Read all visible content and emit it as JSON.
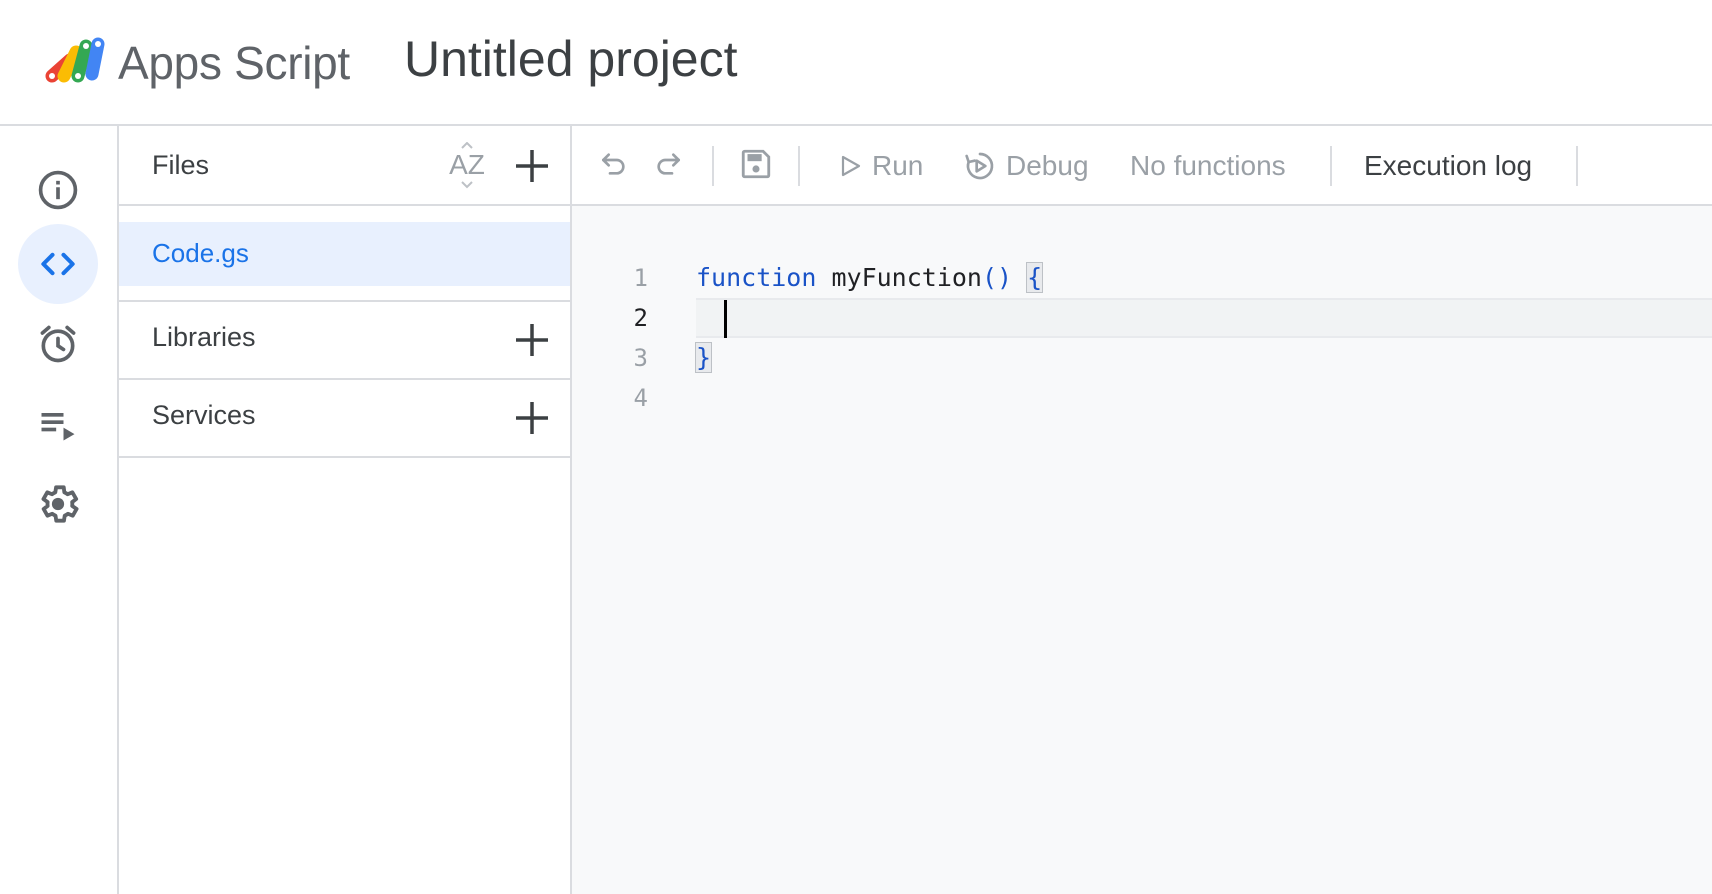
{
  "header": {
    "app_name": "Apps Script",
    "project_title": "Untitled project"
  },
  "rail": {
    "items": [
      {
        "name": "overview",
        "icon": "info-icon",
        "active": false
      },
      {
        "name": "editor",
        "icon": "code-icon",
        "active": true
      },
      {
        "name": "triggers",
        "icon": "alarm-clock-icon",
        "active": false
      },
      {
        "name": "executions",
        "icon": "playlist-play-icon",
        "active": false
      },
      {
        "name": "settings",
        "icon": "gear-icon",
        "active": false
      }
    ]
  },
  "files_panel": {
    "files_label": "Files",
    "sort_icon_text": "AZ",
    "files": [
      {
        "name": "Code.gs",
        "selected": true
      }
    ],
    "libraries_label": "Libraries",
    "services_label": "Services"
  },
  "toolbar": {
    "run_label": "Run",
    "debug_label": "Debug",
    "function_select": "No functions",
    "execution_log_label": "Execution log"
  },
  "editor": {
    "line_numbers": [
      "1",
      "2",
      "3",
      "4"
    ],
    "current_line": 2,
    "code": {
      "keyword": "function",
      "fn_name": " myFunction",
      "parens": "()",
      "open_brace": "{",
      "close_brace": "}"
    }
  },
  "colors": {
    "accent": "#1a73e8",
    "active_bg": "#e8f0fe",
    "border": "#dadce0",
    "editor_bg": "#f8f9fa",
    "disabled_text": "#9aa0a6"
  }
}
